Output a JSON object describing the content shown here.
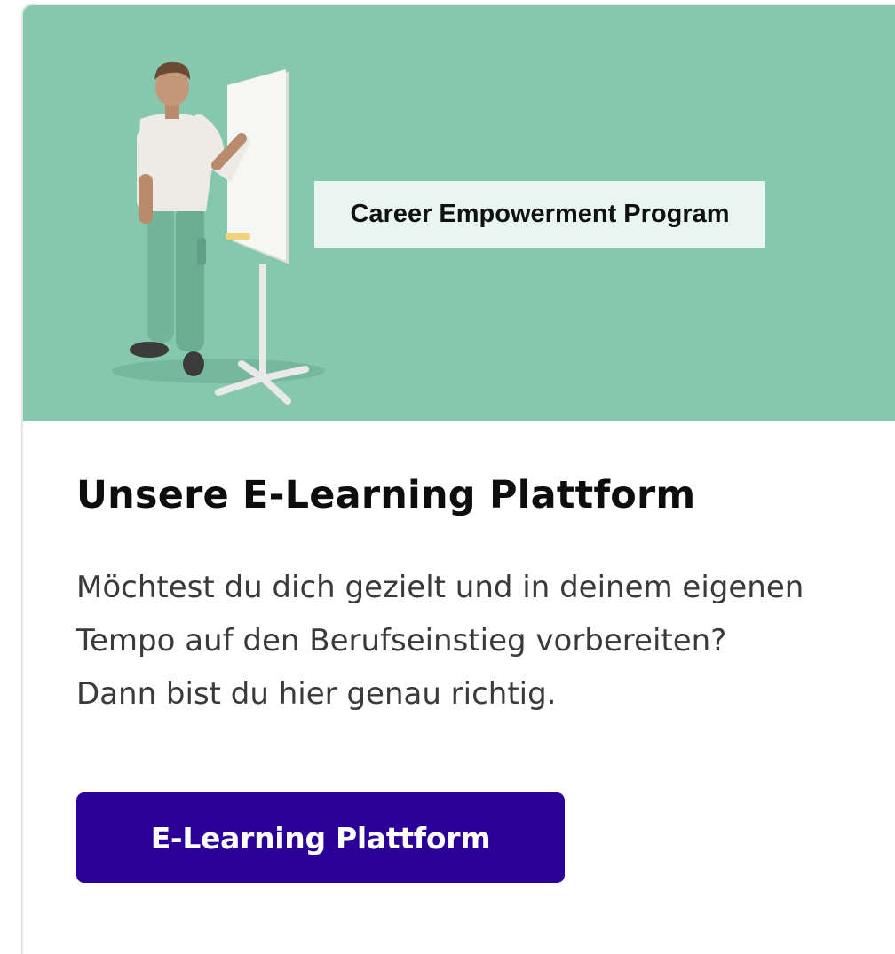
{
  "hero": {
    "label": "Career Empowerment Program",
    "background_color": "#86c8ad",
    "illustration": "presenter-at-whiteboard-illustration"
  },
  "card": {
    "title": "Unsere E-Learning Plattform",
    "description": "Möchtest du dich gezielt und in deinem eigenen Tempo auf den Berufseinstieg vorbereiten? Dann bist du hier genau richtig.",
    "button_label": "E-Learning Plattform",
    "button_color": "#2a0099"
  }
}
